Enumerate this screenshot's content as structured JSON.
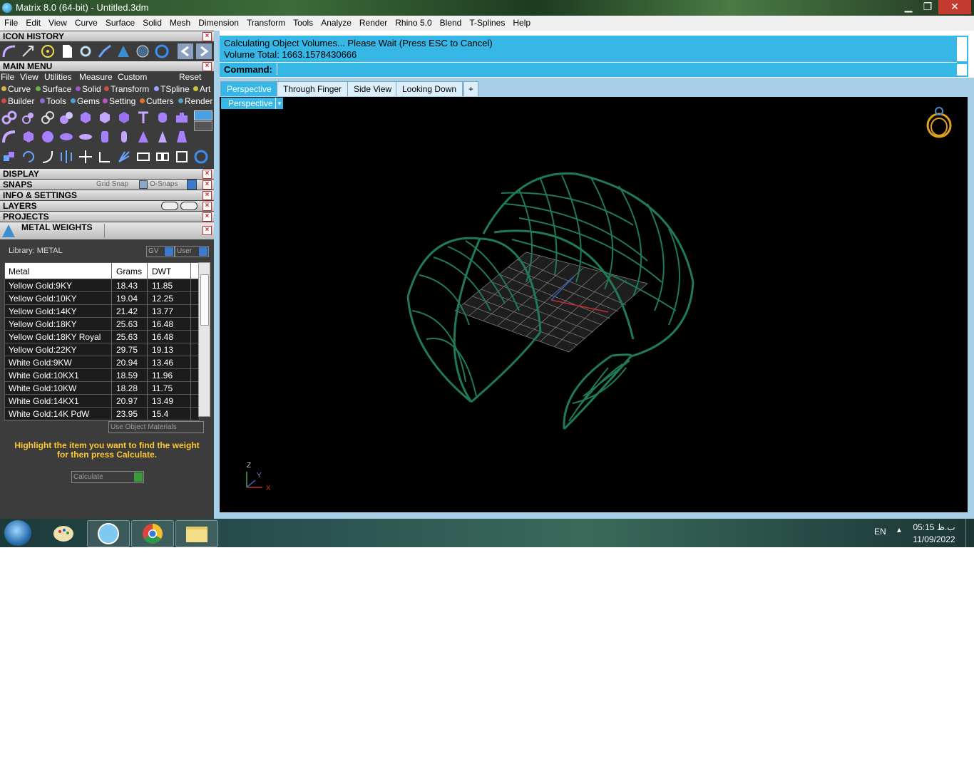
{
  "window": {
    "title": "Matrix 8.0 (64-bit) - Untitled.3dm",
    "minimize": "▁",
    "restore": "❐",
    "close": "✕"
  },
  "menubar": [
    "File",
    "Edit",
    "View",
    "Curve",
    "Surface",
    "Solid",
    "Mesh",
    "Dimension",
    "Transform",
    "Tools",
    "Analyze",
    "Render",
    "Rhino 5.0",
    "Blend",
    "T-Splines",
    "Help"
  ],
  "panels": {
    "icon_history": "ICON HISTORY",
    "main_menu": "MAIN MENU",
    "main_menu_items": [
      "File",
      "View",
      "Utilities",
      "Measure",
      "Custom"
    ],
    "reset": "Reset",
    "tabs_row1": [
      {
        "label": "Curve",
        "color": "#d9b24a"
      },
      {
        "label": "Surface",
        "color": "#6fb04a"
      },
      {
        "label": "Solid",
        "color": "#9a5ad0"
      },
      {
        "label": "Transform",
        "color": "#d04a4a"
      },
      {
        "label": "TSpline",
        "color": "#a0a0ff"
      },
      {
        "label": "Art",
        "color": "#d0c040"
      }
    ],
    "tabs_row2": [
      {
        "label": "Builder",
        "color": "#d04a4a"
      },
      {
        "label": "Tools",
        "color": "#8a6ad0"
      },
      {
        "label": "Gems",
        "color": "#4aa0d0"
      },
      {
        "label": "Setting",
        "color": "#c050c0"
      },
      {
        "label": "Cutters",
        "color": "#e07030"
      },
      {
        "label": "Render",
        "color": "#50a0c0"
      }
    ],
    "display": "DISPLAY",
    "snaps": "SNAPS",
    "grid_snap": "Grid Snap",
    "o_snaps": "O-Snaps",
    "info_settings": "INFO & SETTINGS",
    "layers": "LAYERS",
    "projects": "PROJECTS",
    "metal_weights": "METAL WEIGHTS"
  },
  "metal_weights": {
    "library": "Library: METAL",
    "gv": "GV",
    "user": "User",
    "columns": [
      "Metal",
      "Grams",
      "DWT"
    ],
    "rows": [
      [
        "Yellow Gold:9KY",
        "18.43",
        "11.85"
      ],
      [
        "Yellow Gold:10KY",
        "19.04",
        "12.25"
      ],
      [
        "Yellow Gold:14KY",
        "21.42",
        "13.77"
      ],
      [
        "Yellow Gold:18KY",
        "25.63",
        "16.48"
      ],
      [
        "Yellow Gold:18KY Royal",
        "25.63",
        "16.48"
      ],
      [
        "Yellow Gold:22KY",
        "29.75",
        "19.13"
      ],
      [
        "White Gold:9KW",
        "20.94",
        "13.46"
      ],
      [
        "White Gold:10KX1",
        "18.59",
        "11.96"
      ],
      [
        "White Gold:10KW",
        "18.28",
        "11.75"
      ],
      [
        "White Gold:14KX1",
        "20.97",
        "13.49"
      ],
      [
        "White Gold:14K PdW",
        "23.95",
        "15.4"
      ]
    ],
    "use_object_materials": "Use Object Materials",
    "hint": "Highlight the item you want to find the weight for then press Calculate.",
    "calculate": "Calculate"
  },
  "command": {
    "line1": "Calculating Object Volumes... Please Wait (Press ESC to Cancel)",
    "line2": "Volume Total: 1663.1578430666",
    "prompt": "Command:"
  },
  "viewports": {
    "tabs": [
      "Perspective",
      "Through Finger",
      "Side View",
      "Looking Down"
    ],
    "add_tab": "+",
    "active_label": "Perspective",
    "axis_z": "Z",
    "axis_y": "Y",
    "axis_x": "X"
  },
  "taskbar": {
    "lang": "EN",
    "time": "05:15 ب.ظ",
    "date": "11/09/2022"
  }
}
